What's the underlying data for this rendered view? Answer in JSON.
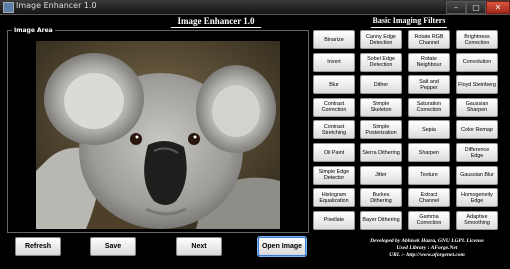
{
  "window": {
    "title": "Image  Enhancer  1.0",
    "minimize": "–",
    "maximize": "▢",
    "close": "✕"
  },
  "header": {
    "title": "Image Enhancer  1.0",
    "filters_title": "Basic Imaging Filters"
  },
  "image_area": {
    "legend": "Image Area",
    "image_alt": "koala photograph"
  },
  "filters": [
    [
      "Binarize",
      "Canny Edge Detection",
      "Rotate RGB Channel",
      "Brightness Correction"
    ],
    [
      "Invert",
      "Sobel Edge Detection",
      "Rotate Neighbour",
      "Convolution"
    ],
    [
      "Blur",
      "Dither",
      "Salt and Pepper",
      "Floyd Steinberg"
    ],
    [
      "Contrast Correction",
      "Simple Skeleton",
      "Saturation Correction",
      "Gaussian Sharpen"
    ],
    [
      "Contrast Stretching",
      "Simple Posterization",
      "Sepia",
      "Color Remap"
    ],
    [
      "Oil Paint",
      "Sierra Dithering",
      "Sharpen",
      "Difference Edge"
    ],
    [
      "Simple Edge Detector",
      "Jitter",
      "Texture",
      "Gaussian Blur"
    ],
    [
      "Histogram Equalization",
      "Burkes Dithering",
      "Extract Channel",
      "Homogeneity Edge"
    ],
    [
      "Pixellate",
      "Bayer Dithering",
      "Gamma Correction",
      "Adaptive Smoothing"
    ]
  ],
  "buttons": {
    "refresh": "Refresh",
    "save": "Save",
    "next": "Next",
    "open_image": "Open Image"
  },
  "credits": {
    "line1": "Developed by  Abhisek Hazra, GNU LGPL License",
    "line2": "Used Library : AForge.Net",
    "line3": "URL :- http://www.aforgenet.com"
  },
  "colors": {
    "background": "#000000",
    "button_face": "#eeeeee",
    "text_light": "#ffffff"
  }
}
